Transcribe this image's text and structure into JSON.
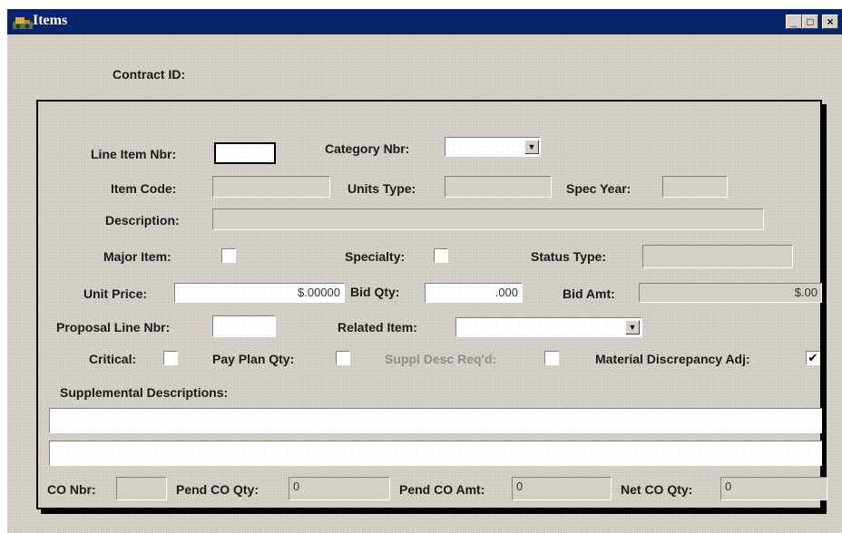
{
  "window": {
    "title": "Items",
    "minimize": "_",
    "maximize": "□",
    "close": "×"
  },
  "header": {
    "contract_id_label": "Contract ID:"
  },
  "form": {
    "line_item_nbr": {
      "label": "Line Item Nbr:",
      "value": ""
    },
    "category_nbr": {
      "label": "Category Nbr:",
      "value": ""
    },
    "item_code": {
      "label": "Item Code:",
      "value": ""
    },
    "units_type": {
      "label": "Units Type:",
      "value": ""
    },
    "spec_year": {
      "label": "Spec Year:",
      "value": ""
    },
    "description": {
      "label": "Description:",
      "value": ""
    },
    "major_item": {
      "label": "Major Item:",
      "checked": false
    },
    "specialty": {
      "label": "Specialty:",
      "checked": false
    },
    "status_type": {
      "label": "Status Type:",
      "value": ""
    },
    "unit_price": {
      "label": "Unit Price:",
      "value": "$.00000"
    },
    "bid_qty": {
      "label": "Bid Qty:",
      "value": ".000"
    },
    "bid_amt": {
      "label": "Bid Amt:",
      "value": "$.00"
    },
    "proposal_line_nbr": {
      "label": "Proposal Line Nbr:",
      "value": ""
    },
    "related_item": {
      "label": "Related Item:",
      "value": ""
    },
    "critical": {
      "label": "Critical:",
      "checked": false
    },
    "pay_plan_qty": {
      "label": "Pay Plan Qty:",
      "checked": false
    },
    "suppl_desc_reqd": {
      "label": "Suppl Desc Req'd:",
      "checked": false,
      "enabled": false
    },
    "material_discrepancy_adj": {
      "label": "Material Discrepancy Adj:",
      "checked": true,
      "mark": "✔"
    },
    "supplemental_descriptions": {
      "label": "Supplemental Descriptions:",
      "line1": "",
      "line2": ""
    },
    "co_nbr": {
      "label": "CO Nbr:",
      "value": ""
    },
    "pend_co_qty": {
      "label": "Pend CO Qty:",
      "value": "0"
    },
    "pend_co_amt": {
      "label": "Pend CO Amt:",
      "value": "0"
    },
    "net_co_qty": {
      "label": "Net CO Qty:",
      "value": "0"
    }
  },
  "icons": {
    "dropdown": "▼",
    "app": "app-icon"
  },
  "colors": {
    "titlebar": "#0a246a",
    "face": "#d4d0c8"
  }
}
